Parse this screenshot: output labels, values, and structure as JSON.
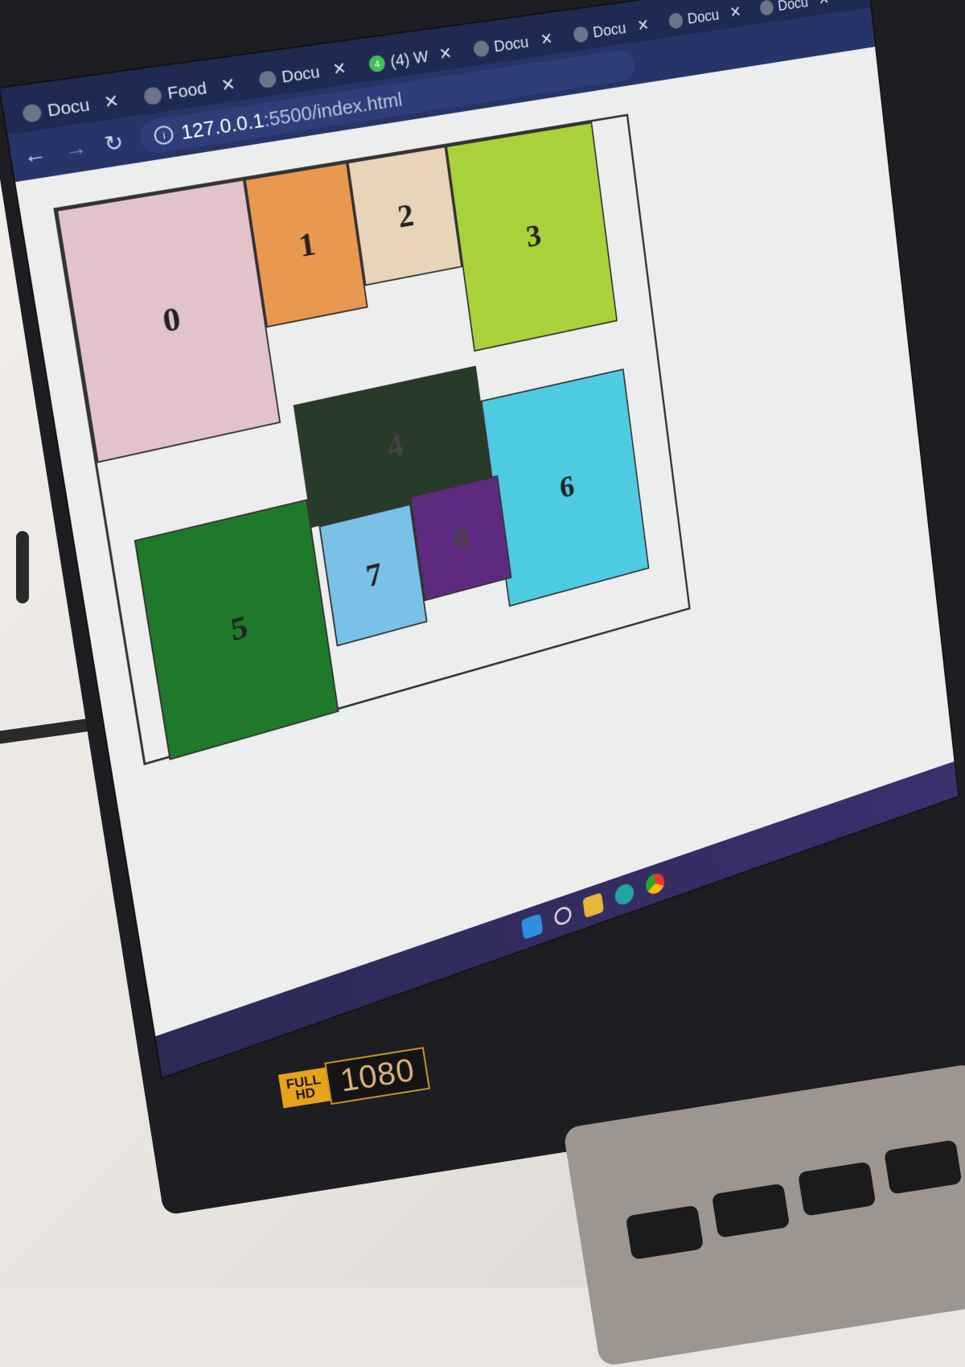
{
  "browser": {
    "tabs": [
      {
        "label": "Docu",
        "icon": "globe-icon"
      },
      {
        "label": "Food",
        "icon": "globe-icon"
      },
      {
        "label": "Docu",
        "icon": "globe-icon"
      },
      {
        "label": "(4) W",
        "icon": "whatsapp-icon",
        "badge": "4"
      },
      {
        "label": "Docu",
        "icon": "globe-icon"
      },
      {
        "label": "Docu",
        "icon": "globe-icon"
      },
      {
        "label": "Docu",
        "icon": "globe-icon"
      },
      {
        "label": "Docu",
        "icon": "globe-icon"
      }
    ],
    "close_glyph": "✕",
    "address": {
      "host": "127.0.0.1",
      "path": ":5500/index.html"
    }
  },
  "grid_items": [
    {
      "label": "0",
      "color": "#e2c3cc"
    },
    {
      "label": "1",
      "color": "#e9994f"
    },
    {
      "label": "2",
      "color": "#e8d4b8"
    },
    {
      "label": "3",
      "color": "#a8d23a"
    },
    {
      "label": "4",
      "color": "#263b28"
    },
    {
      "label": "5",
      "color": "#1e7a2a"
    },
    {
      "label": "6",
      "color": "#4dcbe0"
    },
    {
      "label": "7",
      "color": "#79c1e6"
    },
    {
      "label": "8",
      "color": "#5e2a80"
    }
  ],
  "hardware": {
    "badge_top": "FULL",
    "badge_bottom": "HD",
    "badge_res": "1080"
  }
}
